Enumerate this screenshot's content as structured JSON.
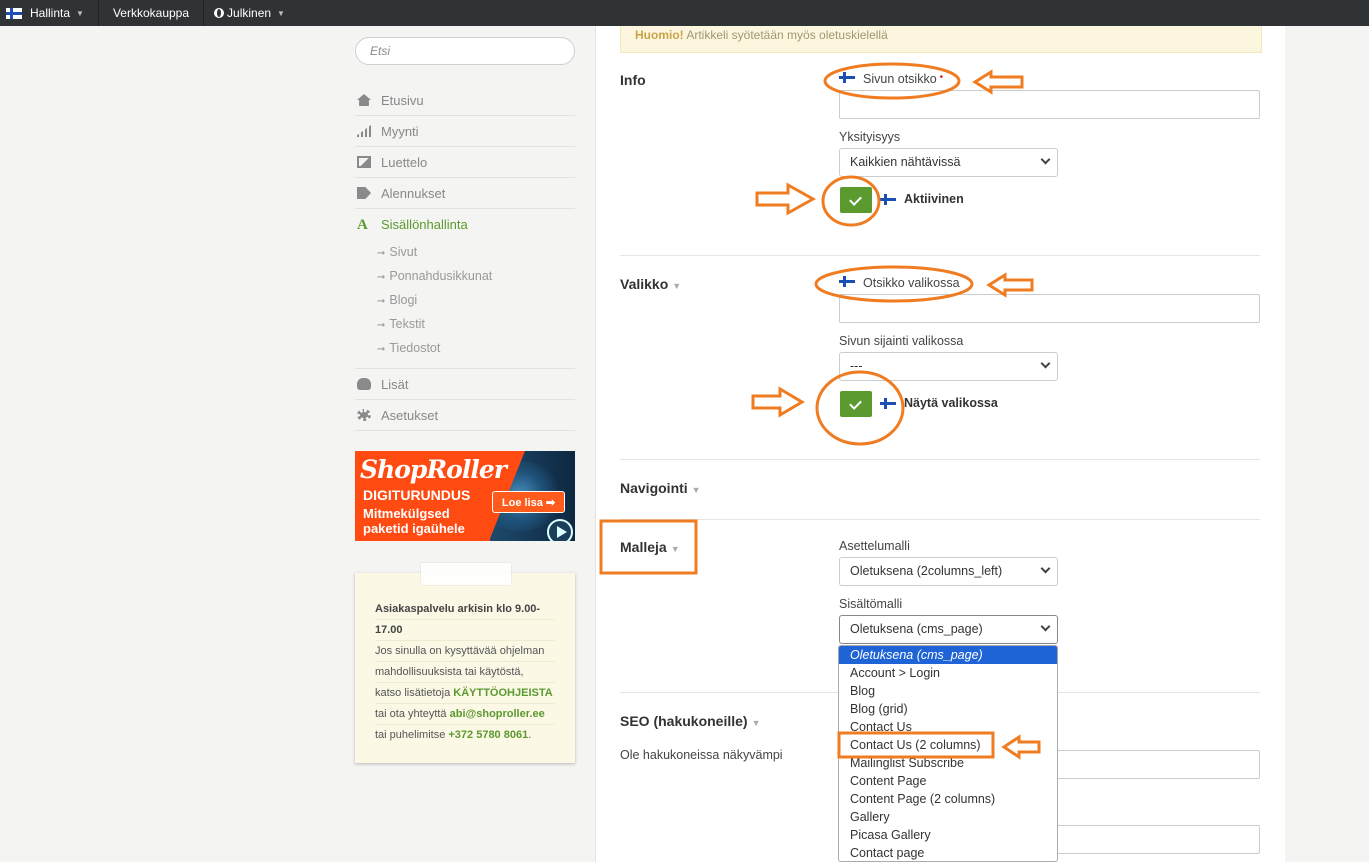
{
  "topbar": {
    "items": [
      {
        "label": "Hallinta",
        "icon": "finland-flag-icon",
        "dropdown": true
      },
      {
        "label": "Verkkokauppa",
        "dropdown": false
      },
      {
        "label": "Julkinen",
        "icon": "globe-icon",
        "dropdown": true
      }
    ]
  },
  "sidebar": {
    "search_placeholder": "Etsi",
    "nav": [
      {
        "label": "Etusivu",
        "icon": "home-icon"
      },
      {
        "label": "Myynti",
        "icon": "bar-chart-icon"
      },
      {
        "label": "Luettelo",
        "icon": "image-icon"
      },
      {
        "label": "Alennukset",
        "icon": "tags-icon"
      },
      {
        "label": "Sisällönhallinta",
        "icon": "content-a-icon",
        "active": true,
        "children": [
          "Sivut",
          "Ponnahdusikkunat",
          "Blogi",
          "Tekstit",
          "Tiedostot"
        ]
      },
      {
        "label": "Lisät",
        "icon": "cloud-icon"
      },
      {
        "label": "Asetukset",
        "icon": "gear-icon"
      }
    ],
    "ad": {
      "logo": "ShopRoller",
      "line1": "DIGITURUNDUS",
      "line2": "Mitmekülgsed",
      "line3": "paketid igaühele",
      "button": "Loe lisa ➡"
    },
    "note": {
      "l1": "Asiakaspalvelu arkisin klo 9.00-",
      "l2": "17.00",
      "l3": "Jos sinulla on kysyttävää ohjelman",
      "l4": "mahdollisuuksista tai käytöstä,",
      "l5_pre": "katso lisätietoja ",
      "l5_link": "KÄYTTÖOHJEISTA",
      "l6_pre": "tai ota yhteyttä ",
      "l6_link": "abi@shoproller.ee",
      "l7_pre": "tai puhelimitse ",
      "l7_link": "+372 5780 8061",
      "l7_post": "."
    }
  },
  "notice": {
    "bold": "Huomio!",
    "text": " Artikkeli syötetään myös oletuskielellä"
  },
  "sections": {
    "info": {
      "title": "Info",
      "page_title_label": "Sivun otsikko",
      "required_mark": "•",
      "page_title_value": "",
      "privacy_label": "Yksityisyys",
      "privacy_value": "Kaikkien nähtävissä",
      "active_label": "Aktiivinen",
      "active_checked": true
    },
    "menu": {
      "title": "Valikko",
      "menu_title_label": "Otsikko valikossa",
      "menu_title_value": "",
      "position_label": "Sivun sijainti valikossa",
      "position_value": "---",
      "show_label": "Näytä valikossa",
      "show_checked": true
    },
    "navigation": {
      "title": "Navigointi"
    },
    "templates": {
      "title": "Malleja",
      "layout_label": "Asettelumalli",
      "layout_value": "Oletuksena (2columns_left)",
      "content_label": "Sisältömalli",
      "content_value": "Oletuksena (cms_page)",
      "content_options": [
        "Oletuksena (cms_page)",
        "Account > Login",
        "Blog",
        "Blog (grid)",
        "Contact Us",
        "Contact Us (2 columns)",
        "Mailinglist Subscribe",
        "Content Page",
        "Content Page (2 columns)",
        "Gallery",
        "Picasa Gallery",
        "Contact page"
      ],
      "selected_index": 0,
      "highlighted_option": "Contact Us (2 columns)"
    },
    "seo": {
      "title": "SEO (hakukoneille)",
      "description": "Ole hakukoneissa näkyvämpi"
    }
  },
  "colors": {
    "accent_green": "#5b9a2f",
    "annotation_orange": "#f07c22",
    "select_blue": "#1f64d6",
    "topbar": "#2f3336"
  }
}
